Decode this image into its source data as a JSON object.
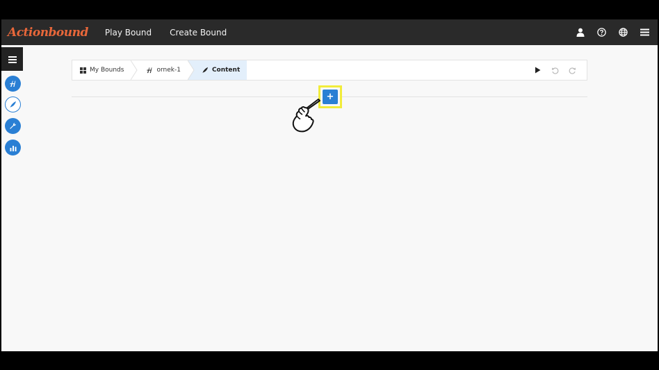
{
  "app": {
    "logo": "Actionbound",
    "brand_color": "#e8673a"
  },
  "navbar": {
    "links": [
      "Play Bound",
      "Create Bound"
    ],
    "icons": [
      "user-icon",
      "help-icon",
      "globe-icon",
      "menu-icon"
    ]
  },
  "sidebar": {
    "toggle_icon": "hamburger-icon",
    "buttons": [
      "bound-icon",
      "content-feather-icon",
      "wrench-icon",
      "statistics-icon"
    ],
    "active_index": 1
  },
  "breadcrumb": {
    "items": [
      {
        "label": "My Bounds",
        "icon": "grid-icon"
      },
      {
        "label": "ornek-1",
        "icon": "bound-icon"
      },
      {
        "label": "Content",
        "icon": "feather-icon"
      }
    ],
    "actions": [
      "play-icon",
      "undo-icon",
      "redo-icon"
    ]
  },
  "editor": {
    "add_label": "+"
  },
  "colors": {
    "accent": "#2a7fd4",
    "highlight": "#f1ec3b",
    "navbar": "#2a2a2a"
  }
}
